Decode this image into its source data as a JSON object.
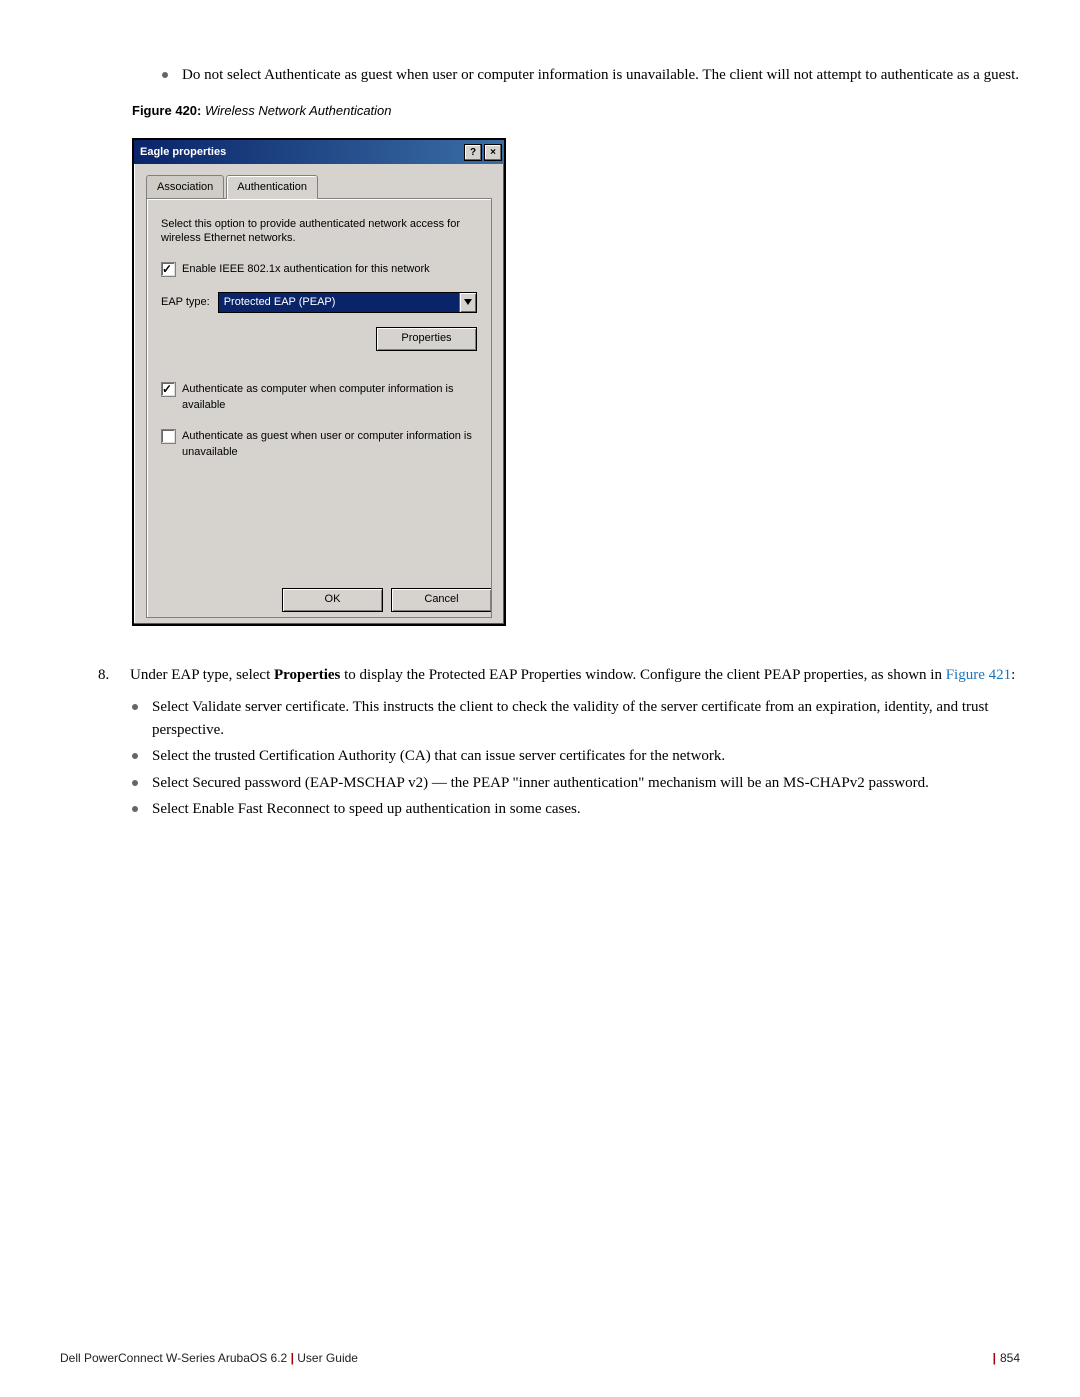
{
  "intro_bullets": [
    "Do not select Authenticate as guest when user or computer information is unavailable. The client will not attempt to authenticate as a guest."
  ],
  "figure": {
    "number": "Figure 420:",
    "title": "Wireless Network Authentication"
  },
  "dialog": {
    "title": "Eagle properties",
    "help_btn": "?",
    "close_btn": "×",
    "tabs": {
      "association": "Association",
      "authentication": "Authentication"
    },
    "desc": "Select this option to provide authenticated network access for wireless Ethernet networks.",
    "enable_8021x": "Enable IEEE 802.1x authentication for this network",
    "eap_type_label": "EAP type:",
    "eap_type_value": "Protected EAP (PEAP)",
    "properties_btn": "Properties",
    "auth_as_computer": "Authenticate as computer when computer information is available",
    "auth_as_guest": "Authenticate as guest when user or computer information is unavailable",
    "ok_btn": "OK",
    "cancel_btn": "Cancel"
  },
  "step8": {
    "num": "8.",
    "text_prefix": "Under EAP type, select ",
    "bold1": "Properties",
    "text_mid": " to display the Protected EAP Properties window. Configure the client PEAP properties, as shown in ",
    "link": "Figure 421",
    "text_suffix": ":",
    "sub_bullets": [
      "Select Validate server certificate. This instructs the client to check the validity of the server certificate from an expiration, identity, and trust perspective.",
      "Select the trusted Certification Authority (CA) that can issue server certificates for the network.",
      "Select Secured password (EAP-MSCHAP v2) — the PEAP \"inner authentication\" mechanism will be an MS-CHAPv2 password.",
      "Select Enable Fast Reconnect to speed up authentication in some cases."
    ]
  },
  "footer": {
    "left": "Dell PowerConnect W-Series ArubaOS 6.2",
    "left2": "User Guide",
    "pagenum": "854"
  }
}
